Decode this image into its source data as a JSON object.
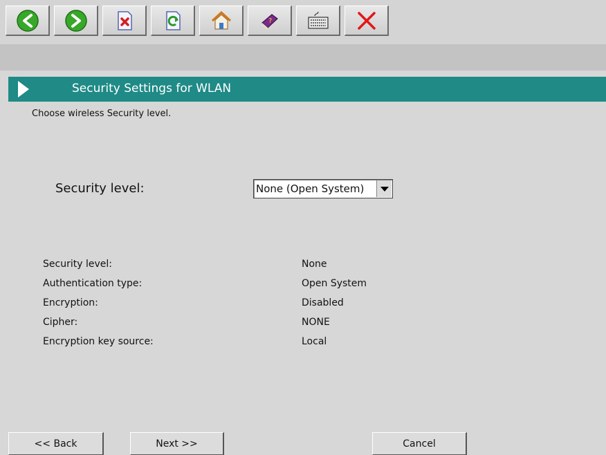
{
  "toolbar": {
    "buttons": [
      {
        "icon": "back-arrow-icon"
      },
      {
        "icon": "forward-arrow-icon"
      },
      {
        "icon": "delete-document-icon"
      },
      {
        "icon": "refresh-document-icon"
      },
      {
        "icon": "home-icon"
      },
      {
        "icon": "help-book-icon"
      },
      {
        "icon": "keyboard-icon"
      },
      {
        "icon": "close-x-icon"
      }
    ]
  },
  "header": {
    "title": "Security Settings for WLAN",
    "accent": "#1f8a86"
  },
  "page": {
    "subtitle": "Choose wireless Security level."
  },
  "security": {
    "label": "Security level:",
    "selected": "None (Open System)"
  },
  "info": [
    {
      "label": "Security level:",
      "value": "None"
    },
    {
      "label": "Authentication type:",
      "value": "Open System"
    },
    {
      "label": "Encryption:",
      "value": "Disabled"
    },
    {
      "label": "Cipher:",
      "value": "NONE"
    },
    {
      "label": "Encryption key source:",
      "value": "Local"
    }
  ],
  "buttons": {
    "back": "<< Back",
    "next": "Next >>",
    "cancel": "Cancel"
  }
}
